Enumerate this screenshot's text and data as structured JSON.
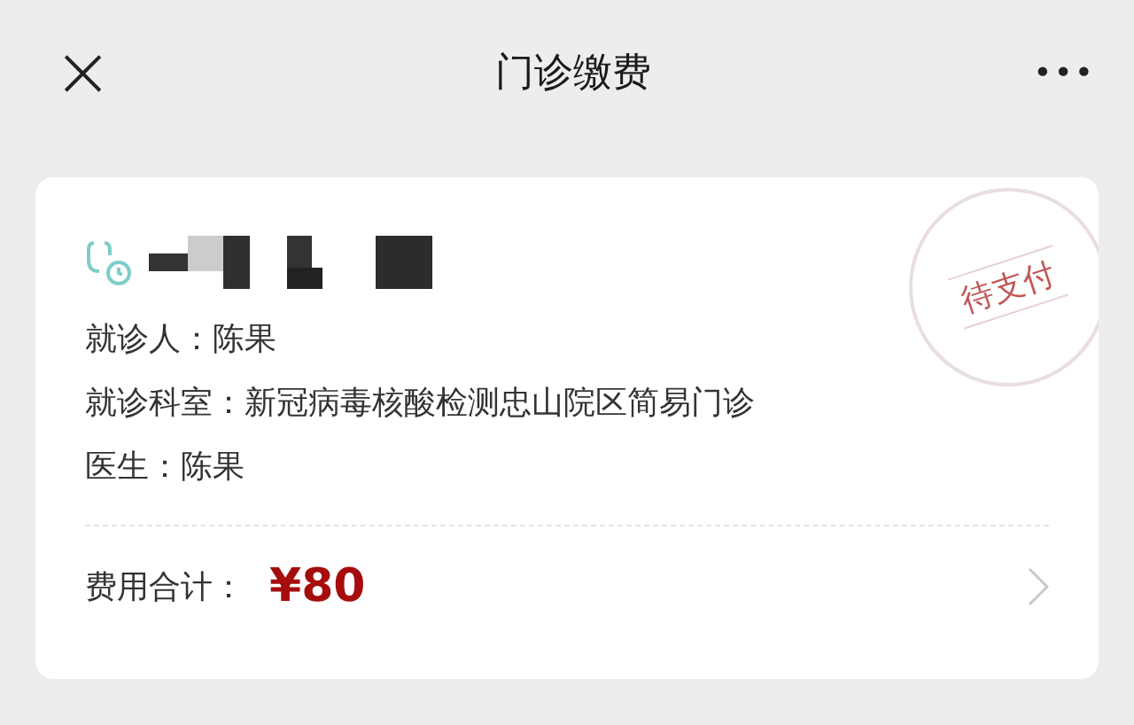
{
  "header": {
    "close": "×",
    "title": "门诊缴费",
    "more": "•••"
  },
  "card": {
    "stamp": "待支付",
    "fields": [
      {
        "label": "就诊人：",
        "value": "陈果"
      },
      {
        "label": "就诊科室：",
        "value": "新冠病毒核酸检测忠山院区简易门诊"
      },
      {
        "label": "医生：",
        "value": "陈果"
      }
    ],
    "total": {
      "label": "费用合计：",
      "amount": "¥80"
    }
  }
}
